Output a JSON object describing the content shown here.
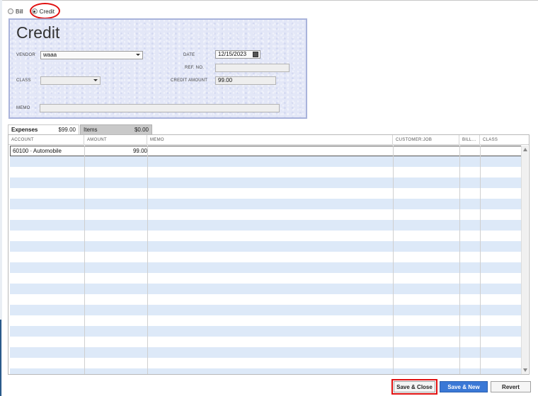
{
  "radio": {
    "options": [
      {
        "label": "Bill",
        "checked": false
      },
      {
        "label": "Credit",
        "checked": true
      }
    ]
  },
  "form": {
    "title": "Credit",
    "vendor_label": "VENDOR",
    "vendor_value": "waaa",
    "class_label": "CLASS",
    "class_value": "",
    "memo_label": "MEMO",
    "memo_value": "",
    "date_label": "DATE",
    "date_value": "12/15/2023",
    "refno_label": "REF. NO.",
    "refno_value": "",
    "credit_amount_label": "CREDIT AMOUNT",
    "credit_amount_value": "99.00"
  },
  "tabs": {
    "expenses_label": "Expenses",
    "expenses_amount": "$99.00",
    "items_label": "Items",
    "items_amount": "$0.00"
  },
  "grid": {
    "headers": [
      "ACCOUNT",
      "AMOUNT",
      "MEMO",
      "CUSTOMER:JOB",
      "BILL...",
      "CLASS"
    ],
    "rows": [
      {
        "account": "60100 · Automobile",
        "amount": "99.00",
        "memo": "",
        "customer_job": "",
        "billable": "",
        "class": ""
      }
    ]
  },
  "buttons": {
    "save_close": "Save & Close",
    "save_new": "Save & New",
    "revert": "Revert"
  },
  "colors": {
    "panel_bg": "#e3e7f7",
    "row_alt": "#dde9f8",
    "primary_button": "#3a78d6",
    "highlight": "#e01010"
  }
}
